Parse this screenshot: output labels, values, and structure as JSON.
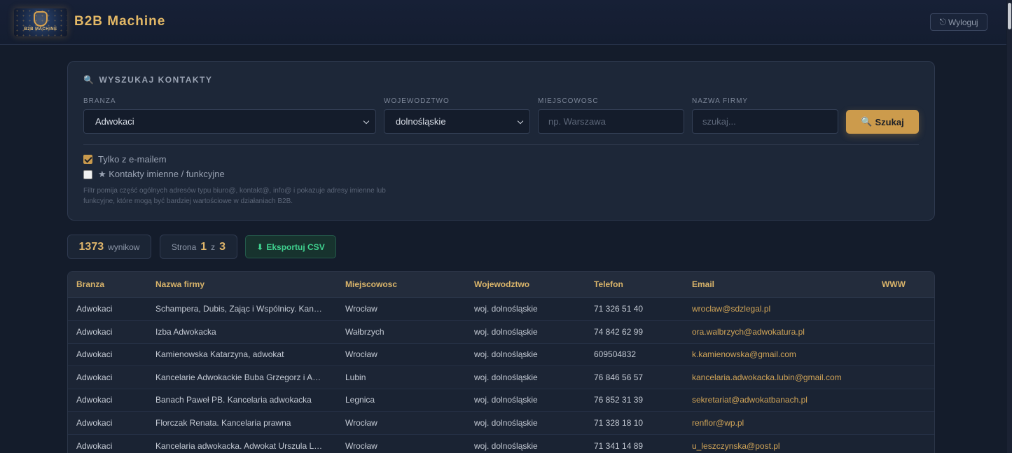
{
  "header": {
    "logo_text": "B2B MACHINE",
    "brand": "B2B Machine",
    "logout_label": "Wyloguj",
    "logout_icon": "logout-icon"
  },
  "search": {
    "title": "WYSZUKAJ KONTAKTY",
    "title_icon": "search-icon",
    "branza_label": "BRANZA",
    "branza_value": "Adwokaci",
    "wojewodztwo_label": "WOJEWODZTWO",
    "wojewodztwo_value": "dolnośląskie",
    "miejscowosc_label": "MIEJSCOWOSC",
    "miejscowosc_placeholder": "np. Warszawa",
    "nazwa_label": "NAZWA FIRMY",
    "nazwa_placeholder": "szukaj...",
    "search_button": "Szukaj",
    "only_email_label": "Tylko z e-mailem",
    "only_email_checked": true,
    "named_contacts_label": "★ Kontakty imienne / funkcyjne",
    "named_contacts_checked": false,
    "note": "Filtr pomija część ogólnych adresów typu biuro@, kontakt@, info@ i pokazuje adresy imienne lub funkcyjne, które mogą być bardziej wartościowe w działaniach B2B."
  },
  "stats": {
    "results_count": "1373",
    "results_label": "wynikow",
    "page_label": "Strona",
    "page_current": "1",
    "page_of": "z",
    "page_total": "3",
    "export_label": "Eksportuj CSV",
    "export_icon": "download-icon"
  },
  "table": {
    "headers": [
      "Branza",
      "Nazwa firmy",
      "Miejscowosc",
      "Wojewodztwo",
      "Telefon",
      "Email",
      "WWW"
    ],
    "rows": [
      {
        "branza": "Adwokaci",
        "nazwa": "Schampera, Dubis, Zając i Wspólnicy. Kancelaria",
        "miejscowosc": "Wrocław",
        "woj": "woj. dolnośląskie",
        "telefon": "71 326 51 40",
        "email": "wroclaw@sdzlegal.pl",
        "www": ""
      },
      {
        "branza": "Adwokaci",
        "nazwa": "Izba Adwokacka",
        "miejscowosc": "Wałbrzych",
        "woj": "woj. dolnośląskie",
        "telefon": "74 842 62 99",
        "email": "ora.walbrzych@adwokatura.pl",
        "www": ""
      },
      {
        "branza": "Adwokaci",
        "nazwa": "Kamienowska Katarzyna, adwokat",
        "miejscowosc": "Wrocław",
        "woj": "woj. dolnośląskie",
        "telefon": "609504832",
        "email": "k.kamienowska@gmail.com",
        "www": ""
      },
      {
        "branza": "Adwokaci",
        "nazwa": "Kancelarie Adwokackie Buba Grzegorz i Anna",
        "miejscowosc": "Lubin",
        "woj": "woj. dolnośląskie",
        "telefon": "76 846 56 57",
        "email": "kancelaria.adwokacka.lubin@gmail.com",
        "www": ""
      },
      {
        "branza": "Adwokaci",
        "nazwa": "Banach Paweł PB. Kancelaria adwokacka",
        "miejscowosc": "Legnica",
        "woj": "woj. dolnośląskie",
        "telefon": "76 852 31 39",
        "email": "sekretariat@adwokatbanach.pl",
        "www": ""
      },
      {
        "branza": "Adwokaci",
        "nazwa": "Florczak Renata. Kancelaria prawna",
        "miejscowosc": "Wrocław",
        "woj": "woj. dolnośląskie",
        "telefon": "71 328 18 10",
        "email": "renflor@wp.pl",
        "www": ""
      },
      {
        "branza": "Adwokaci",
        "nazwa": "Kancelaria adwokacka. Adwokat Urszula Leszczyńska",
        "miejscowosc": "Wrocław",
        "woj": "woj. dolnośląskie",
        "telefon": "71 341 14 89",
        "email": "u_leszczynska@post.pl",
        "www": ""
      }
    ]
  }
}
